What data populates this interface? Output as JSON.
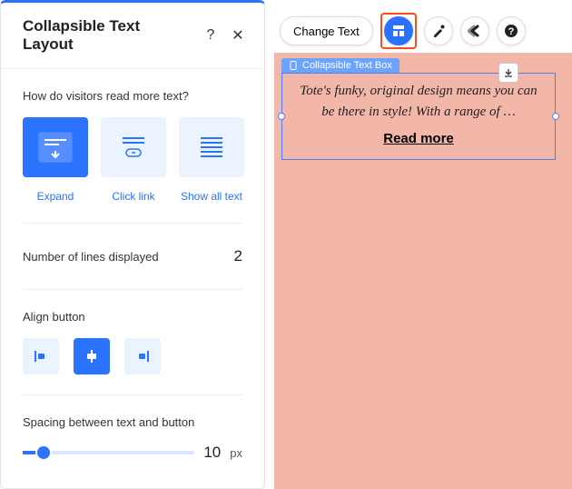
{
  "panel": {
    "title": "Collapsible Text Layout",
    "help_icon": "?",
    "close_icon": "✕",
    "read_mode": {
      "label": "How do visitors read more text?",
      "options": [
        {
          "id": "expand",
          "caption": "Expand"
        },
        {
          "id": "link",
          "caption": "Click link"
        },
        {
          "id": "showall",
          "caption": "Show all text"
        }
      ],
      "active": "expand"
    },
    "lines": {
      "label": "Number of lines displayed",
      "value": "2"
    },
    "align": {
      "label": "Align button",
      "options": [
        "left",
        "center",
        "right"
      ],
      "active": "center"
    },
    "spacing": {
      "label": "Spacing between text and button",
      "value": "10",
      "unit": "px"
    }
  },
  "toolbar": {
    "change_text": "Change Text"
  },
  "canvas": {
    "element_label": "Collapsible Text Box",
    "sample_text": "Tote's funky, original design means you can be there in style! With a range of …",
    "read_more": "Read more"
  }
}
